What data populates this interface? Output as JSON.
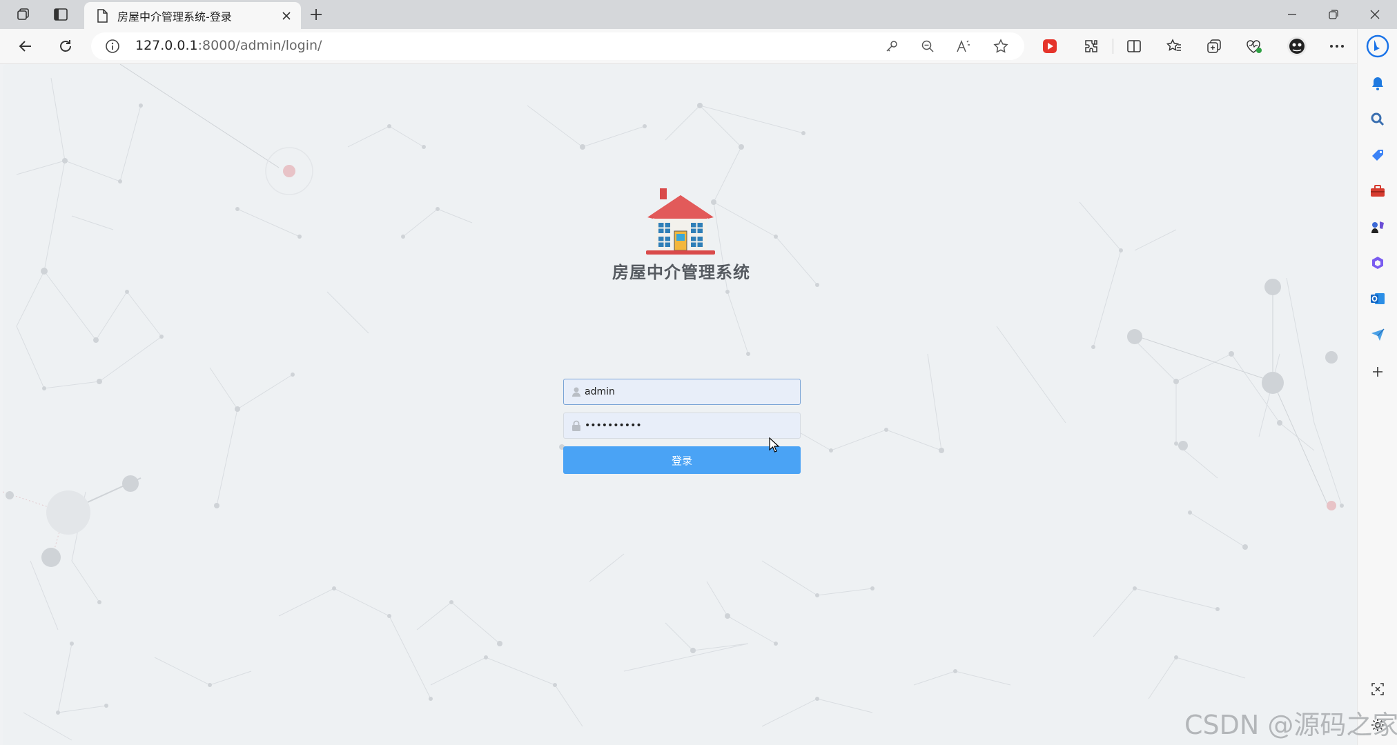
{
  "browser": {
    "tab_title": "房屋中介管理系统-登录",
    "url_host": "127.0.0.1",
    "url_rest": ":8000/admin/login/"
  },
  "login": {
    "system_title": "房屋中介管理系统",
    "username_value": "admin",
    "password_value": "••••••••••",
    "submit_label": "登录"
  },
  "colors": {
    "primary_button": "#4aa3f5",
    "page_background": "#eef1f3",
    "input_background": "#e8eef9"
  },
  "watermark": "CSDN @源码之家"
}
